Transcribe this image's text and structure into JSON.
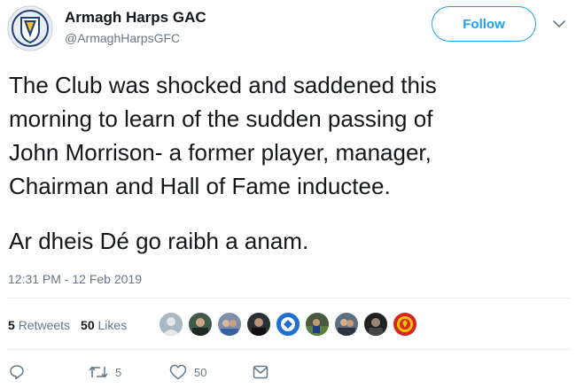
{
  "account": {
    "name": "Armagh Harps GAC",
    "handle": "@ArmaghHarpsGFC",
    "avatar_icon": "club-crest-icon"
  },
  "follow_button": {
    "label": "Follow",
    "color": "#1da1f2"
  },
  "tweet": {
    "lines": [
      "The Club was shocked and saddened this",
      "morning to learn of the sudden passing of",
      "John Morrison- a former player, manager,",
      "Chairman and Hall of Fame inductee."
    ],
    "closing_line": "Ar dheis Dé go raibh a anam.",
    "timestamp": "12:31 PM - 12 Feb 2019"
  },
  "stats": {
    "retweets_count": "5",
    "retweets_label": "Retweets",
    "likes_count": "50",
    "likes_label": "Likes"
  },
  "likers": [
    {
      "icon": "default-avatar-icon",
      "bg": "#aab8c2"
    },
    {
      "icon": "user-photo-icon",
      "bg": "#3f5a4a"
    },
    {
      "icon": "user-photo-icon",
      "bg": "#7d8fa8"
    },
    {
      "icon": "user-photo-icon",
      "bg": "#2a2f36"
    },
    {
      "icon": "user-photo-icon",
      "bg": "#1d6fd0"
    },
    {
      "icon": "user-photo-icon",
      "bg": "#4a5a3e"
    },
    {
      "icon": "user-photo-icon",
      "bg": "#5b6e7e"
    },
    {
      "icon": "user-photo-icon",
      "bg": "#222222"
    },
    {
      "icon": "club-badge-icon",
      "bg": "#d7261e"
    }
  ],
  "actions": {
    "reply_icon": "reply-icon",
    "retweet_icon": "retweet-icon",
    "retweet_count": "5",
    "like_icon": "heart-icon",
    "like_count": "50",
    "message_icon": "direct-message-icon"
  },
  "colors": {
    "text": "#14171a",
    "secondary": "#657786",
    "accent": "#1da1f2",
    "divider": "#e6ecf0"
  }
}
